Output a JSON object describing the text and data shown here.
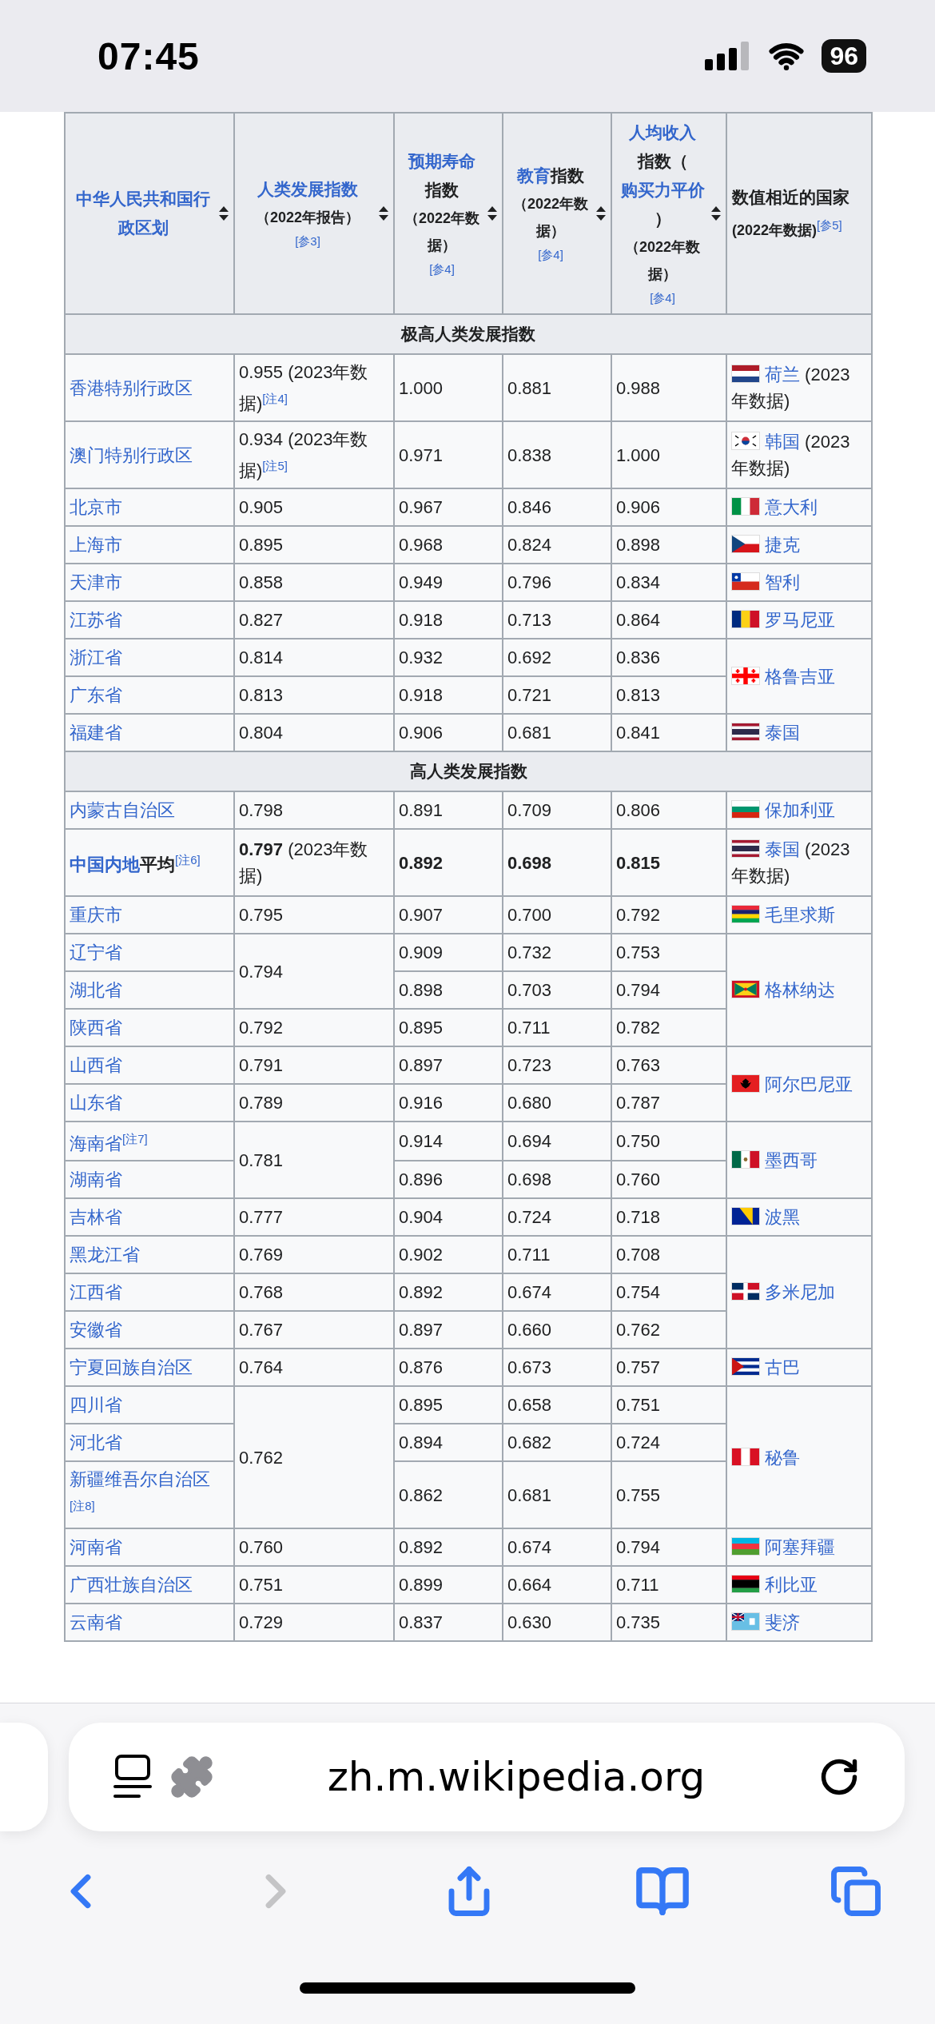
{
  "status_bar": {
    "time": "07:45",
    "battery": "96"
  },
  "table": {
    "columns": [
      {
        "parts": [
          {
            "text": "中华人民共和国行政区划",
            "link": true
          }
        ],
        "sortable": true
      },
      {
        "parts": [
          {
            "text": "人类发展指数",
            "link": true
          }
        ],
        "sub": "（2022年报告）",
        "ref": "[参3]",
        "sortable": true
      },
      {
        "parts": [
          {
            "text": "预期寿命",
            "link": true
          },
          {
            "text": "指数",
            "link": false
          }
        ],
        "sub": "（2022年数据）",
        "ref": "[参4]",
        "sortable": true
      },
      {
        "parts": [
          {
            "text": "教育",
            "link": true
          },
          {
            "text": "指数",
            "link": false
          }
        ],
        "sub": "（2022年数据）",
        "ref": "[参4]",
        "sortable": true
      },
      {
        "parts": [
          {
            "text": "人均收入",
            "link": true
          },
          {
            "text": "指数",
            "link": false
          },
          {
            "text": "（",
            "link": false
          },
          {
            "text": "购买力平价",
            "link": true
          },
          {
            "text": "）",
            "link": false
          }
        ],
        "sub": "（2022年数据）",
        "ref": "[参4]",
        "sortable": true
      },
      {
        "parts": [
          {
            "text": "数值相近的国家",
            "link": false
          }
        ],
        "sub": "(2022年数据)",
        "sub_ref": "[参5]",
        "sortable": false
      }
    ],
    "sections": [
      {
        "title": "极高人类发展指数",
        "countries": [
          {
            "country": "荷兰",
            "suffix": " (2023年数据)",
            "kind": "netherlands",
            "hdi_groups": [
              {
                "hdi": "0.955 (2023年数据)",
                "note": "[注4]",
                "rows": [
                  {
                    "kind": "region",
                    "region": "香港特别行政区",
                    "life": "1.000",
                    "edu": "0.881",
                    "income": "0.988"
                  }
                ]
              }
            ]
          },
          {
            "country": "韩国",
            "suffix": " (2023年数据)",
            "kind": "korea",
            "hdi_groups": [
              {
                "hdi": "0.934 (2023年数据)",
                "note": "[注5]",
                "rows": [
                  {
                    "kind": "region",
                    "region": "澳门特别行政区",
                    "life": "0.971",
                    "edu": "0.838",
                    "income": "1.000"
                  }
                ]
              }
            ]
          },
          {
            "country": "意大利",
            "kind": "italy",
            "hdi_groups": [
              {
                "hdi": "0.905",
                "rows": [
                  {
                    "kind": "region",
                    "region": "北京市",
                    "life": "0.967",
                    "edu": "0.846",
                    "income": "0.906"
                  }
                ]
              }
            ]
          },
          {
            "country": "捷克",
            "kind": "czech",
            "hdi_groups": [
              {
                "hdi": "0.895",
                "rows": [
                  {
                    "kind": "region",
                    "region": "上海市",
                    "life": "0.968",
                    "edu": "0.824",
                    "income": "0.898"
                  }
                ]
              }
            ]
          },
          {
            "country": "智利",
            "kind": "chile",
            "hdi_groups": [
              {
                "hdi": "0.858",
                "rows": [
                  {
                    "kind": "region",
                    "region": "天津市",
                    "life": "0.949",
                    "edu": "0.796",
                    "income": "0.834"
                  }
                ]
              }
            ]
          },
          {
            "country": "罗马尼亚",
            "kind": "romania",
            "hdi_groups": [
              {
                "hdi": "0.827",
                "rows": [
                  {
                    "kind": "region",
                    "region": "江苏省",
                    "life": "0.918",
                    "edu": "0.713",
                    "income": "0.864"
                  }
                ]
              }
            ]
          },
          {
            "country": "格鲁吉亚",
            "kind": "georgia",
            "hdi_groups": [
              {
                "hdi": "0.814",
                "rows": [
                  {
                    "kind": "region",
                    "region": "浙江省",
                    "life": "0.932",
                    "edu": "0.692",
                    "income": "0.836"
                  }
                ]
              },
              {
                "hdi": "0.813",
                "rows": [
                  {
                    "kind": "region",
                    "region": "广东省",
                    "life": "0.918",
                    "edu": "0.721",
                    "income": "0.813"
                  }
                ]
              }
            ]
          },
          {
            "country": "泰国",
            "kind": "thailand",
            "hdi_groups": [
              {
                "hdi": "0.804",
                "rows": [
                  {
                    "kind": "region",
                    "region": "福建省",
                    "life": "0.906",
                    "edu": "0.681",
                    "income": "0.841"
                  }
                ]
              }
            ]
          }
        ]
      },
      {
        "title": "高人类发展指数",
        "countries": [
          {
            "country": "保加利亚",
            "kind": "bulgaria",
            "hdi_groups": [
              {
                "hdi": "0.798",
                "rows": [
                  {
                    "kind": "region",
                    "region": "内蒙古自治区",
                    "life": "0.891",
                    "edu": "0.709",
                    "income": "0.806"
                  }
                ]
              }
            ]
          },
          {
            "country": "泰国",
            "suffix": " (2023年数据)",
            "kind": "thailand",
            "hdi_groups": [
              {
                "hdi": "**0.797** (2023年数据)",
                "rows": [
                  {
                    "kind": "average",
                    "region": "中国内地",
                    "region_suffix": "平均",
                    "note": "[注6]",
                    "life": "0.892",
                    "edu": "0.698",
                    "income": "0.815"
                  }
                ]
              }
            ]
          },
          {
            "country": "毛里求斯",
            "kind": "mauritius",
            "hdi_groups": [
              {
                "hdi": "0.795",
                "rows": [
                  {
                    "kind": "region",
                    "region": "重庆市",
                    "life": "0.907",
                    "edu": "0.700",
                    "income": "0.792"
                  }
                ]
              }
            ]
          },
          {
            "country": "格林纳达",
            "kind": "grenada",
            "hdi_groups": [
              {
                "hdi": "0.794",
                "rows": [
                  {
                    "kind": "region",
                    "region": "辽宁省",
                    "life": "0.909",
                    "edu": "0.732",
                    "income": "0.753"
                  },
                  {
                    "kind": "region",
                    "region": "湖北省",
                    "life": "0.898",
                    "edu": "0.703",
                    "income": "0.794"
                  }
                ]
              },
              {
                "hdi": "0.792",
                "rows": [
                  {
                    "kind": "region",
                    "region": "陕西省",
                    "life": "0.895",
                    "edu": "0.711",
                    "income": "0.782"
                  }
                ]
              }
            ]
          },
          {
            "country": "阿尔巴尼亚",
            "kind": "albania",
            "hdi_groups": [
              {
                "hdi": "0.791",
                "rows": [
                  {
                    "kind": "region",
                    "region": "山西省",
                    "life": "0.897",
                    "edu": "0.723",
                    "income": "0.763"
                  }
                ]
              },
              {
                "hdi": "0.789",
                "rows": [
                  {
                    "kind": "region",
                    "region": "山东省",
                    "life": "0.916",
                    "edu": "0.680",
                    "income": "0.787"
                  }
                ]
              }
            ]
          },
          {
            "country": "墨西哥",
            "kind": "mexico",
            "hdi_groups": [
              {
                "hdi": "0.781",
                "rows": [
                  {
                    "kind": "region",
                    "region": "海南省",
                    "note": "[注7]",
                    "life": "0.914",
                    "edu": "0.694",
                    "income": "0.750"
                  },
                  {
                    "kind": "region",
                    "region": "湖南省",
                    "life": "0.896",
                    "edu": "0.698",
                    "income": "0.760"
                  }
                ]
              }
            ]
          },
          {
            "country": "波黑",
            "kind": "bosnia",
            "hdi_groups": [
              {
                "hdi": "0.777",
                "rows": [
                  {
                    "kind": "region",
                    "region": "吉林省",
                    "life": "0.904",
                    "edu": "0.724",
                    "income": "0.718"
                  }
                ]
              }
            ]
          },
          {
            "country": "多米尼加",
            "kind": "dominican",
            "hdi_groups": [
              {
                "hdi": "0.769",
                "rows": [
                  {
                    "kind": "region",
                    "region": "黑龙江省",
                    "life": "0.902",
                    "edu": "0.711",
                    "income": "0.708"
                  }
                ]
              },
              {
                "hdi": "0.768",
                "rows": [
                  {
                    "kind": "region",
                    "region": "江西省",
                    "life": "0.892",
                    "edu": "0.674",
                    "income": "0.754"
                  }
                ]
              },
              {
                "hdi": "0.767",
                "rows": [
                  {
                    "kind": "region",
                    "region": "安徽省",
                    "life": "0.897",
                    "edu": "0.660",
                    "income": "0.762"
                  }
                ]
              }
            ]
          },
          {
            "country": "古巴",
            "kind": "cuba",
            "hdi_groups": [
              {
                "hdi": "0.764",
                "rows": [
                  {
                    "kind": "region",
                    "region": "宁夏回族自治区",
                    "life": "0.876",
                    "edu": "0.673",
                    "income": "0.757"
                  }
                ]
              }
            ]
          },
          {
            "country": "秘鲁",
            "kind": "peru",
            "hdi_groups": [
              {
                "hdi": "0.762",
                "rows": [
                  {
                    "kind": "region",
                    "region": "四川省",
                    "life": "0.895",
                    "edu": "0.658",
                    "income": "0.751"
                  },
                  {
                    "kind": "region",
                    "region": "河北省",
                    "life": "0.894",
                    "edu": "0.682",
                    "income": "0.724"
                  },
                  {
                    "kind": "region",
                    "region": "新疆维吾尔自治区",
                    "note": "[注8]",
                    "life": "0.862",
                    "edu": "0.681",
                    "income": "0.755"
                  }
                ]
              }
            ]
          },
          {
            "country": "阿塞拜疆",
            "kind": "azerbaijan",
            "hdi_groups": [
              {
                "hdi": "0.760",
                "rows": [
                  {
                    "kind": "region",
                    "region": "河南省",
                    "life": "0.892",
                    "edu": "0.674",
                    "income": "0.794"
                  }
                ]
              }
            ]
          },
          {
            "country": "利比亚",
            "kind": "libya",
            "hdi_groups": [
              {
                "hdi": "0.751",
                "rows": [
                  {
                    "kind": "region",
                    "region": "广西壮族自治区",
                    "life": "0.899",
                    "edu": "0.664",
                    "income": "0.711"
                  }
                ]
              }
            ]
          },
          {
            "country": "斐济",
            "kind": "fiji",
            "hdi_groups": [
              {
                "hdi": "0.729",
                "rows": [
                  {
                    "kind": "region",
                    "region": "云南省",
                    "life": "0.837",
                    "edu": "0.630",
                    "income": "0.735"
                  }
                ]
              }
            ]
          }
        ]
      }
    ]
  },
  "browser": {
    "url": "zh.m.wikipedia.org",
    "forward_disabled": true
  }
}
